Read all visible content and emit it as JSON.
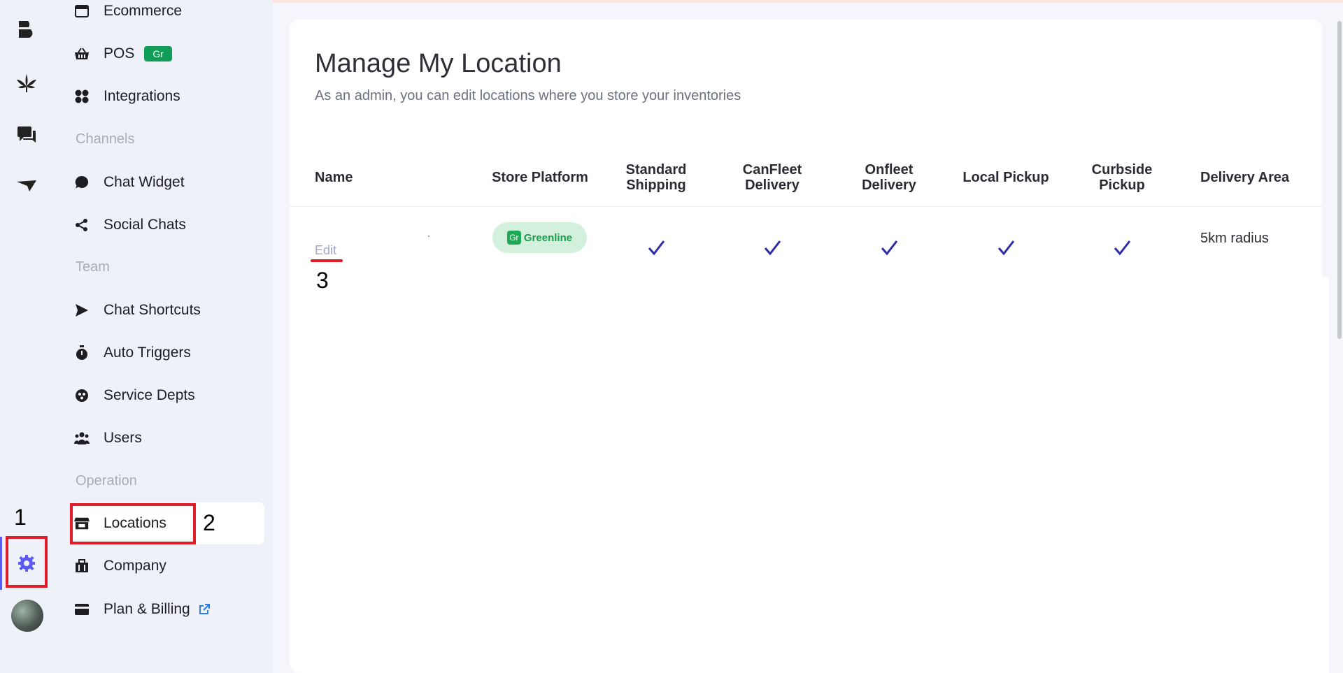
{
  "sidebar": {
    "items_top": [
      {
        "label": "Ecommerce",
        "icon": "browser-window-icon"
      },
      {
        "label": "POS",
        "icon": "basket-icon",
        "badge": "Gr"
      },
      {
        "label": "Integrations",
        "icon": "grid-icon"
      }
    ],
    "channels_heading": "Channels",
    "channels": [
      {
        "label": "Chat Widget",
        "icon": "chat-bubble-icon"
      },
      {
        "label": "Social Chats",
        "icon": "share-icon"
      }
    ],
    "team_heading": "Team",
    "team": [
      {
        "label": "Chat Shortcuts",
        "icon": "send-icon"
      },
      {
        "label": "Auto Triggers",
        "icon": "stopwatch-icon"
      },
      {
        "label": "Service Depts",
        "icon": "support-icon"
      },
      {
        "label": "Users",
        "icon": "users-icon"
      }
    ],
    "operation_heading": "Operation",
    "operation": [
      {
        "label": "Locations",
        "icon": "store-icon"
      },
      {
        "label": "Company",
        "icon": "briefcase-icon"
      },
      {
        "label": "Plan & Billing",
        "icon": "credit-card-icon"
      }
    ]
  },
  "main": {
    "title": "Manage My Location",
    "subtitle": "As an admin, you can edit locations where you store your inventories",
    "columns": {
      "name": "Name",
      "store_platform": "Store Platform",
      "standard_shipping_1": "Standard",
      "standard_shipping_2": "Shipping",
      "canfleet_1": "CanFleet",
      "canfleet_2": "Delivery",
      "onfleet_1": "Onfleet",
      "onfleet_2": "Delivery",
      "local_pickup": "Local Pickup",
      "curbside_1": "Curbside",
      "curbside_2": "Pickup",
      "delivery_area": "Delivery Area"
    },
    "row": {
      "edit_label": "Edit",
      "platform_badge_icon": "Gr",
      "platform_name": "Greenline",
      "standard_shipping": true,
      "canfleet_delivery": true,
      "onfleet_delivery": true,
      "local_pickup": true,
      "curbside_pickup": true,
      "delivery_area": "5km radius"
    }
  },
  "annotations": {
    "step1": "1",
    "step2": "2",
    "step3": "3"
  },
  "colors": {
    "accent": "#5b5bf0",
    "highlight": "#e11d2a",
    "badge_green": "#0f9d58",
    "check": "#2c2ca8"
  }
}
